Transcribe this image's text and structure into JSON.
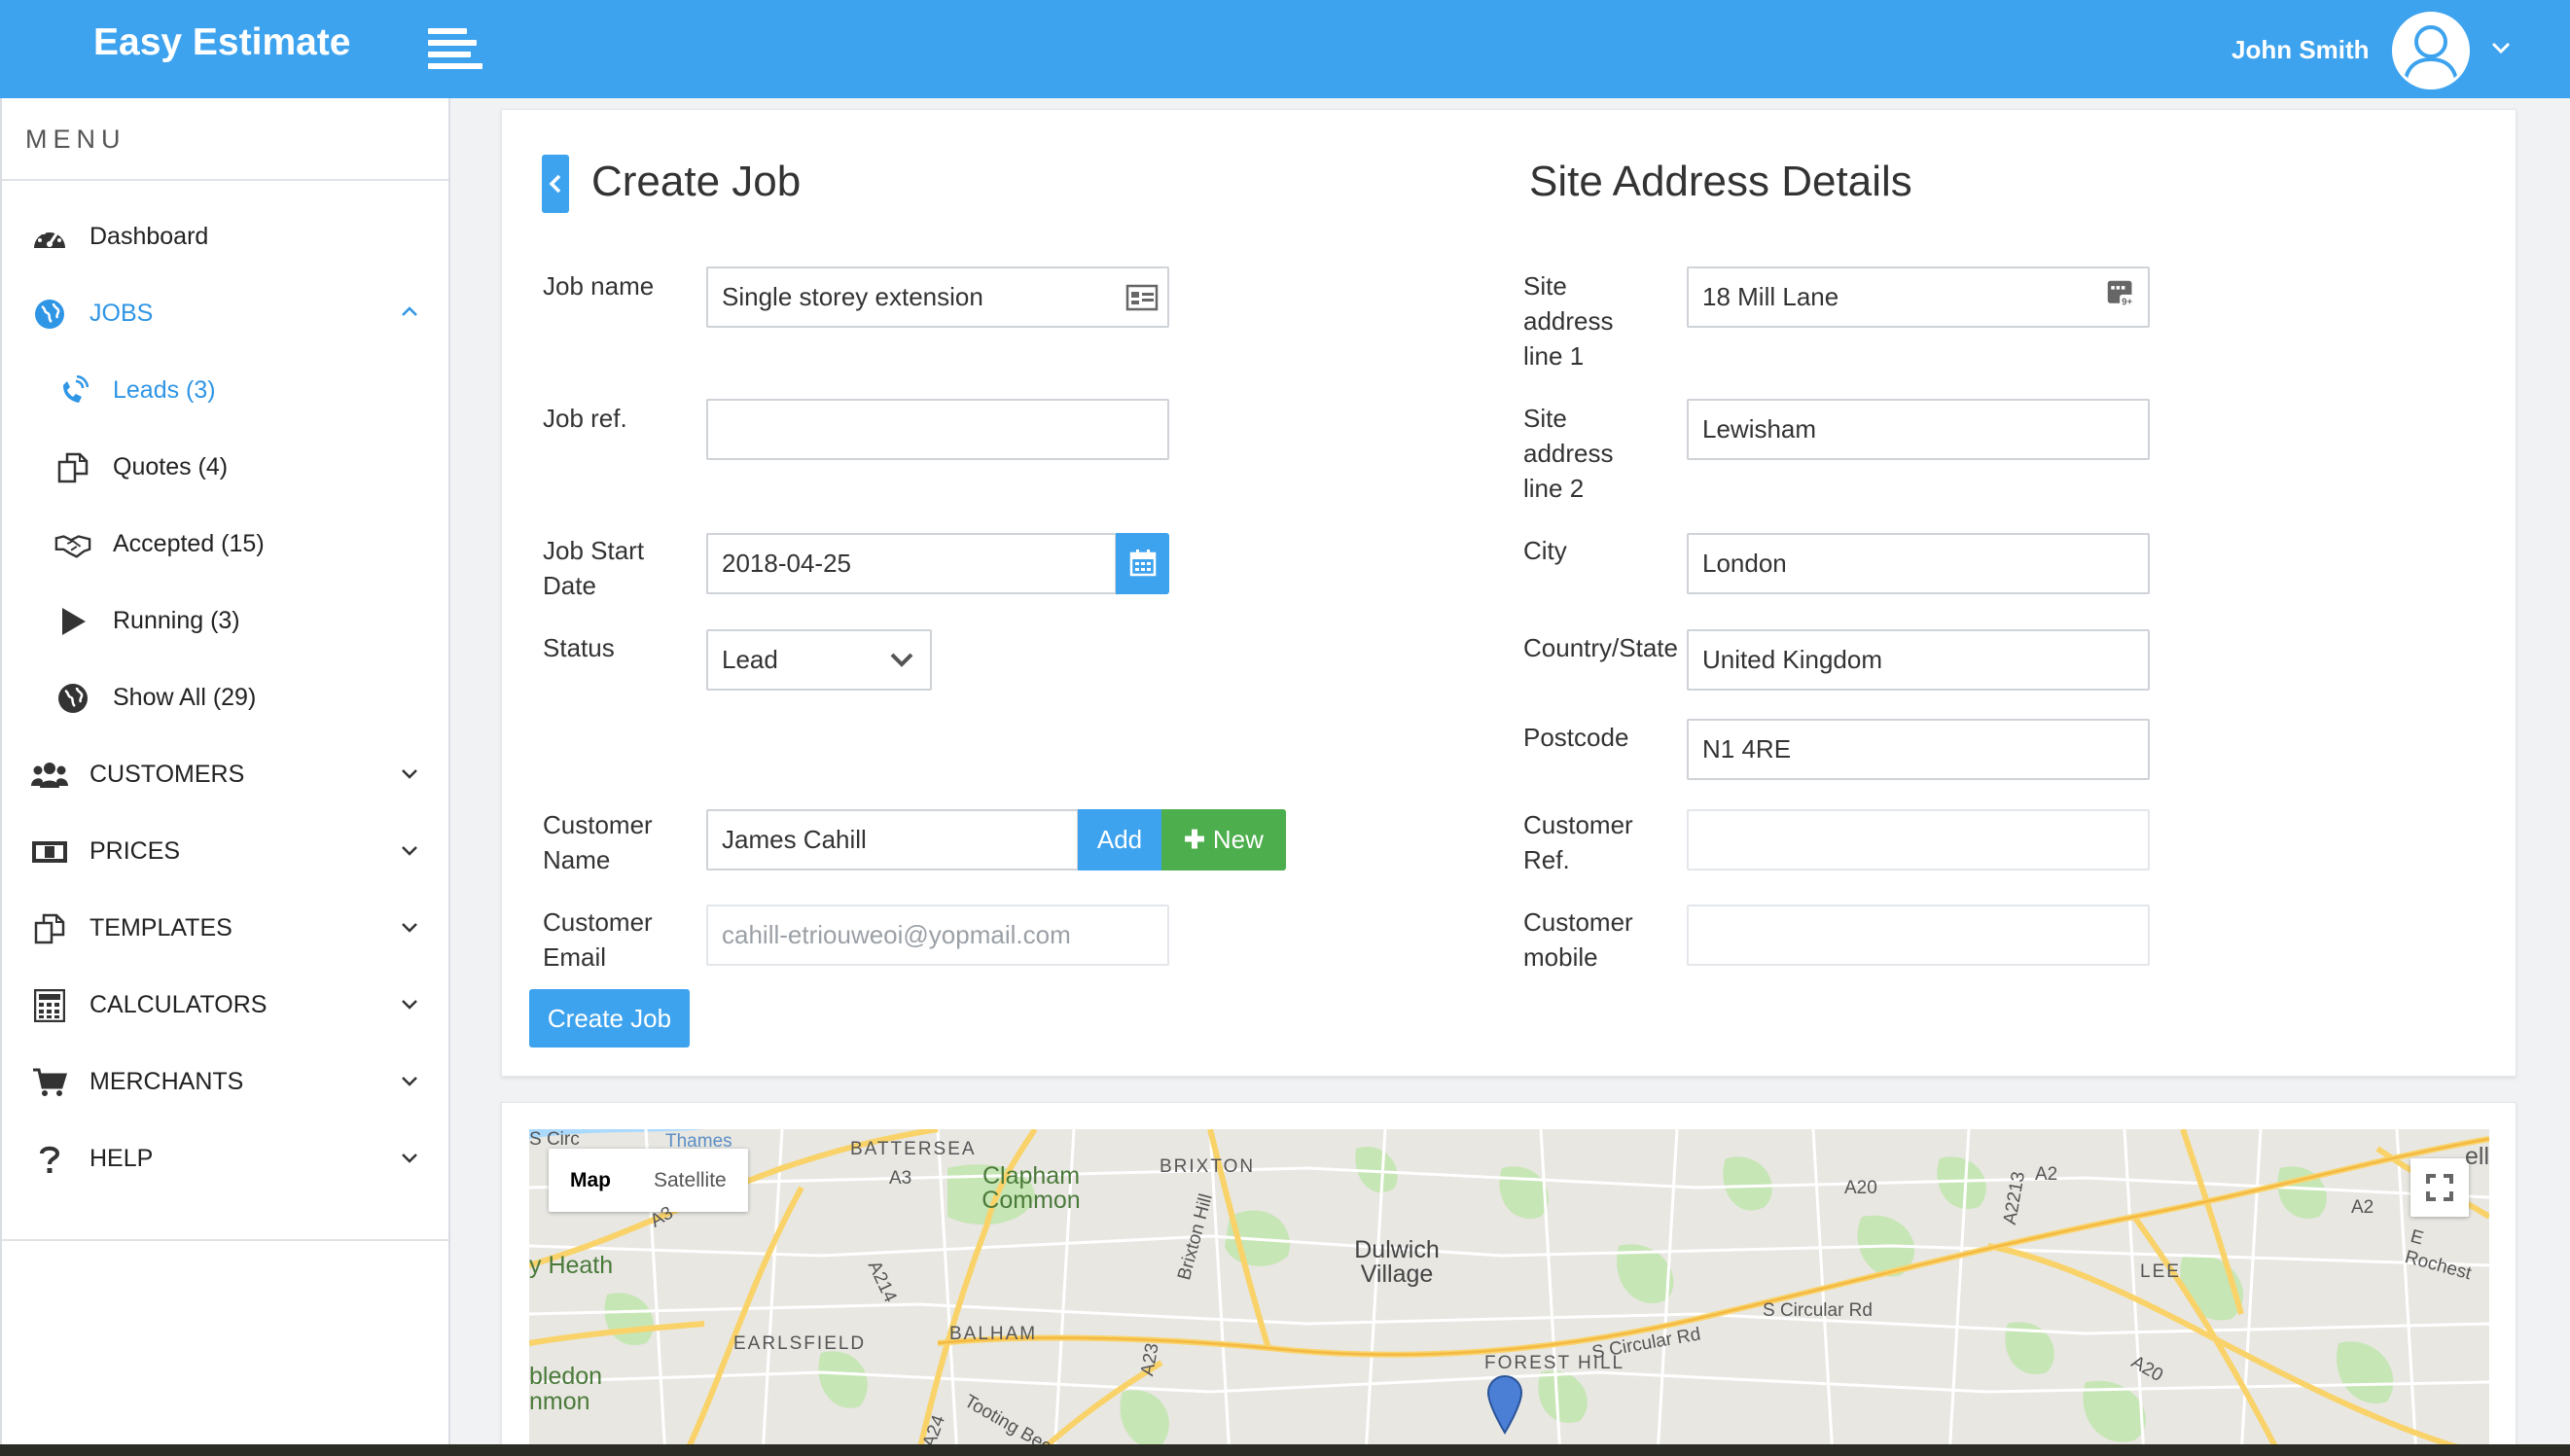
{
  "app": {
    "brand": "Easy Estimate"
  },
  "header": {
    "user_name": "John Smith"
  },
  "sidebar": {
    "menu_title": "MENU",
    "items": [
      {
        "label": "Dashboard",
        "icon": "dashboard-icon"
      },
      {
        "label": "JOBS",
        "icon": "globe-icon",
        "expanded": true
      },
      {
        "label": "Leads (3)",
        "icon": "phone-icon"
      },
      {
        "label": "Quotes (4)",
        "icon": "copy-icon"
      },
      {
        "label": "Accepted (15)",
        "icon": "handshake-icon"
      },
      {
        "label": "Running (3)",
        "icon": "play-icon"
      },
      {
        "label": "Show All (29)",
        "icon": "globe-icon"
      },
      {
        "label": "CUSTOMERS",
        "icon": "users-icon"
      },
      {
        "label": "PRICES",
        "icon": "money-icon"
      },
      {
        "label": "TEMPLATES",
        "icon": "copy-icon"
      },
      {
        "label": "CALCULATORS",
        "icon": "calculator-icon"
      },
      {
        "label": "MERCHANTS",
        "icon": "cart-icon"
      },
      {
        "label": "HELP",
        "icon": "question-icon"
      }
    ]
  },
  "form": {
    "title": "Create Job",
    "site_title": "Site Address Details",
    "job_name": {
      "label": "Job name",
      "value": "Single storey extension"
    },
    "job_ref": {
      "label": "Job ref.",
      "value": ""
    },
    "job_start": {
      "label": "Job Start Date",
      "value": "2018-04-25"
    },
    "status": {
      "label": "Status",
      "value": "Lead"
    },
    "customer_name": {
      "label": "Customer Name",
      "value": "James Cahill"
    },
    "customer_email": {
      "label": "Customer Email",
      "placeholder": "cahill-etriouweoi@yopmail.com"
    },
    "add_label": "Add",
    "new_label": "New",
    "create_label": "Create Job",
    "site1": {
      "label": "Site address line 1",
      "value": "18 Mill Lane"
    },
    "site2": {
      "label": "Site address line 2",
      "value": "Lewisham"
    },
    "city": {
      "label": "City",
      "value": "London"
    },
    "country": {
      "label": "Country/State",
      "value": "United Kingdom"
    },
    "postcode": {
      "label": "Postcode",
      "value": "N1 4RE"
    },
    "customer_ref": {
      "label": "Customer Ref.",
      "value": ""
    },
    "customer_mobile": {
      "label": "Customer mobile",
      "value": ""
    }
  },
  "map": {
    "map_label": "Map",
    "satellite_label": "Satellite",
    "places": [
      "BATTERSEA",
      "Clapham Common",
      "BRIXTON",
      "Dulwich Village",
      "EARLSFIELD",
      "BALHAM",
      "FOREST HILL",
      "LEE",
      "S Circular Rd",
      "S Circular Rd",
      "A20",
      "A2",
      "A2",
      "A3",
      "A3",
      "A214",
      "A23",
      "A24",
      "A20",
      "A2213",
      "E Rochest",
      "y Heath",
      "Brixton Hill",
      "Tooting Bec Rd",
      "Thames",
      "ell",
      "bledon",
      "nmon",
      "S Circ"
    ]
  },
  "colors": {
    "primary": "#3ea3ee",
    "success": "#4cae4c",
    "active_nav": "#2f95e5"
  }
}
